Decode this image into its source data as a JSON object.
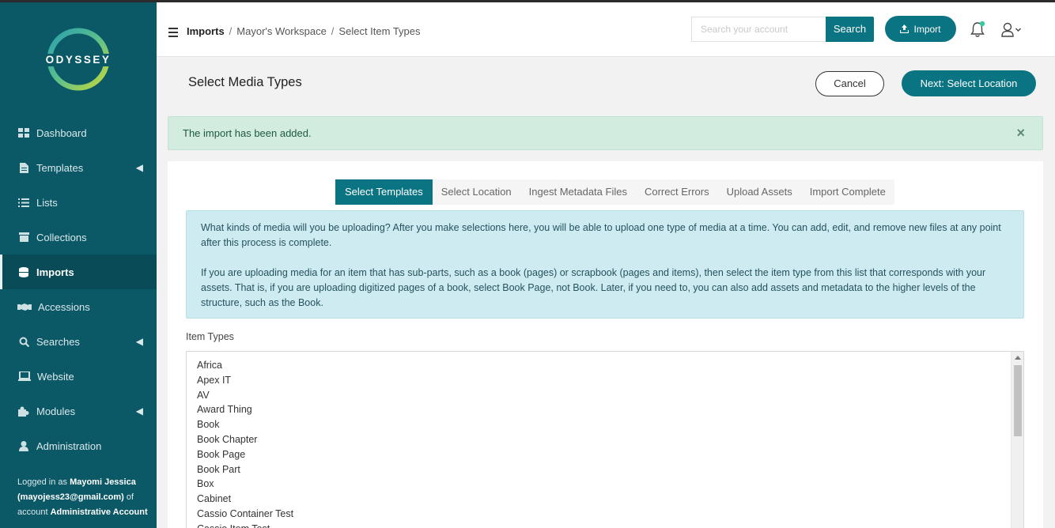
{
  "logo": {
    "text": "ODYSSEY"
  },
  "sidebar": {
    "items": [
      {
        "label": "Dashboard",
        "icon": "dashboard-icon",
        "has_chevron": false
      },
      {
        "label": "Templates",
        "icon": "file-icon",
        "has_chevron": true
      },
      {
        "label": "Lists",
        "icon": "list-icon",
        "has_chevron": false
      },
      {
        "label": "Collections",
        "icon": "archive-icon",
        "has_chevron": false
      },
      {
        "label": "Imports",
        "icon": "database-icon",
        "has_chevron": false,
        "active": true
      },
      {
        "label": "Accessions",
        "icon": "handshake-icon",
        "has_chevron": false
      },
      {
        "label": "Searches",
        "icon": "search-icon",
        "has_chevron": true
      },
      {
        "label": "Website",
        "icon": "laptop-icon",
        "has_chevron": false
      },
      {
        "label": "Modules",
        "icon": "puzzle-icon",
        "has_chevron": true
      },
      {
        "label": "Administration",
        "icon": "user-icon",
        "has_chevron": false
      }
    ],
    "logged_in": {
      "prefix": "Logged in as",
      "name": "Mayomi Jessica",
      "email": "(mayojess23@gmail.com)",
      "mid": "of account",
      "account": "Administrative Account"
    }
  },
  "header": {
    "breadcrumb": [
      "Imports",
      "Mayor's Workspace",
      "Select Item Types"
    ],
    "search_placeholder": "Search your account",
    "search_label": "Search",
    "import_label": "Import"
  },
  "subheader": {
    "title": "Select Media Types",
    "cancel_label": "Cancel",
    "next_label": "Next: Select Location"
  },
  "alert": {
    "text": "The import has been added.",
    "close": "×"
  },
  "steps": [
    "Select Templates",
    "Select Location",
    "Ingest Metadata Files",
    "Correct Errors",
    "Upload Assets",
    "Import Complete"
  ],
  "info": {
    "p1": "What kinds of media will you be uploading? After you make selections here, you will be able to upload one type of media at a time. You can add, edit, and remove new files at any point after this process is complete.",
    "p2": "If you are uploading media for an item that has sub-parts, such as a book (pages) or scrapbook (pages and items), then select the item type from this list that corresponds with your assets. That is, if you are uploading digitized pages of a book, select Book Page, not Book. Later, if you need to, you can also add assets and metadata to the higher levels of the structure, such as the Book."
  },
  "item_types": {
    "label": "Item Types",
    "options": [
      "Africa",
      "Apex IT",
      "AV",
      "Award Thing",
      "Book",
      "Book Chapter",
      "Book Page",
      "Book Part",
      "Box",
      "Cabinet",
      "Cassio Container Test",
      "Cassio Item Test"
    ]
  },
  "colors": {
    "sidebar": "#0b5866",
    "accent": "#0b7482",
    "alert_bg": "#d3ece0",
    "info_bg": "#cdebf1"
  }
}
